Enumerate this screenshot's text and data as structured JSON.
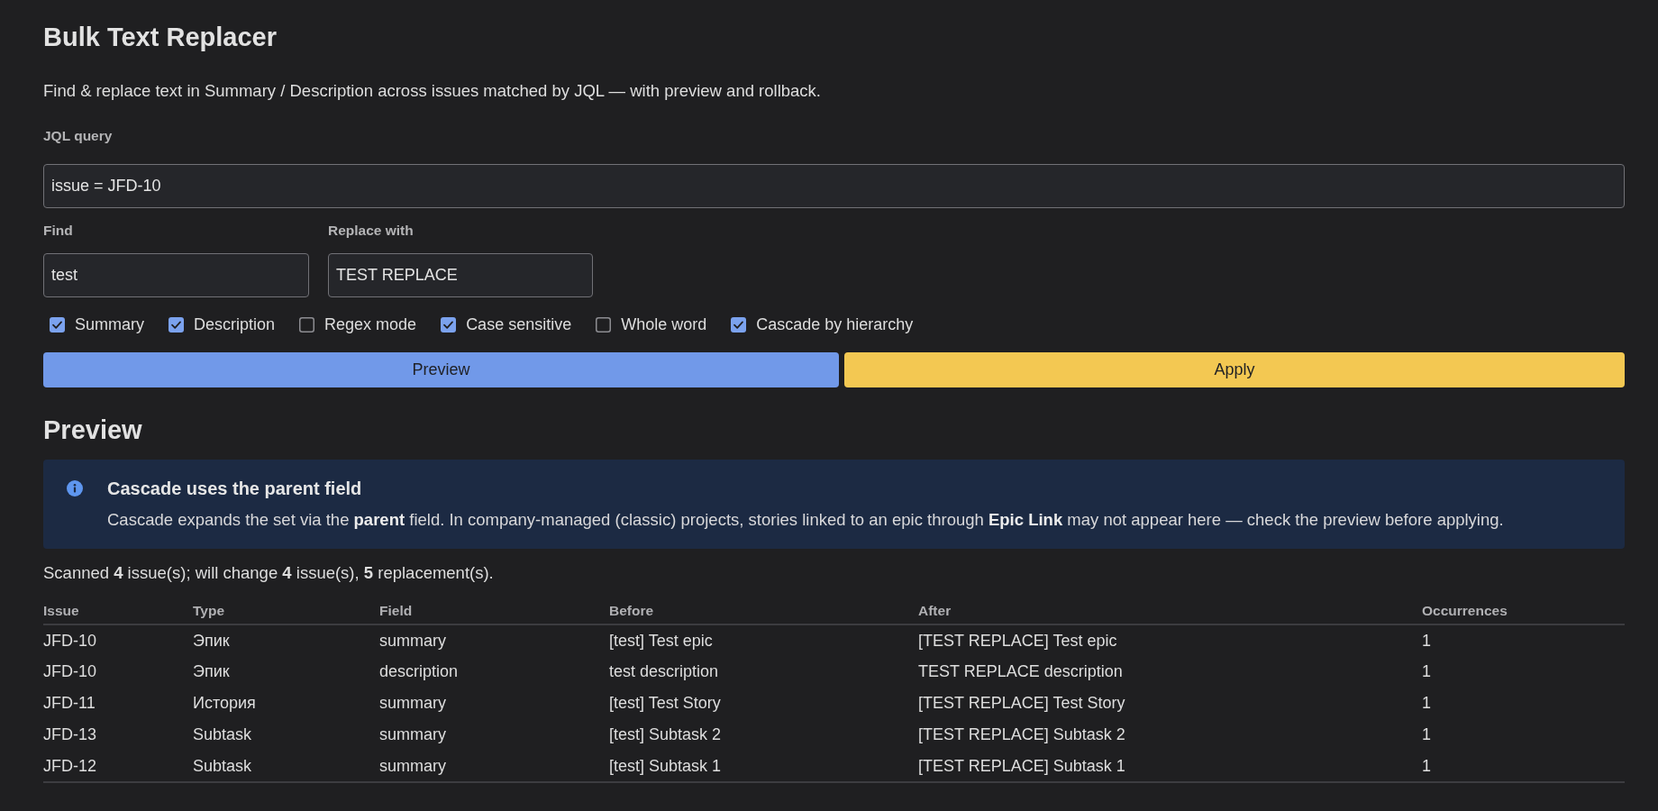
{
  "app": {
    "title": "Bulk Text Replacer",
    "subtitle": "Find & replace text in Summary / Description across issues matched by JQL — with preview and rollback."
  },
  "form": {
    "jql": {
      "label": "JQL query",
      "value": "issue = JFD-10"
    },
    "find": {
      "label": "Find",
      "value": "test"
    },
    "replace": {
      "label": "Replace with",
      "value": "TEST REPLACE"
    },
    "options": [
      {
        "label": "Summary",
        "checked": true
      },
      {
        "label": "Description",
        "checked": true
      },
      {
        "label": "Regex mode",
        "checked": false
      },
      {
        "label": "Case sensitive",
        "checked": true
      },
      {
        "label": "Whole word",
        "checked": false
      },
      {
        "label": "Cascade by hierarchy",
        "checked": true
      }
    ],
    "buttons": [
      {
        "label": "Preview",
        "kind": "primary"
      },
      {
        "label": "Apply",
        "kind": "warning"
      }
    ]
  },
  "preview": {
    "heading": "Preview",
    "notice": {
      "title": "Cascade uses the parent field",
      "body": "Cascade expands the set via the **parent** field. In company-managed (classic) projects, stories linked to an epic through **Epic Link** may not appear here — check the preview before applying."
    },
    "summary": "Scanned **4** issue(s); will change **4** issue(s), **5** replacement(s).",
    "table": {
      "columns": [
        "Issue",
        "Type",
        "Field",
        "Before",
        "After",
        "Occurrences"
      ],
      "rows": [
        [
          "JFD-10",
          "Эпик",
          "summary",
          "[test] Test epic",
          "[TEST REPLACE] Test epic",
          "1"
        ],
        [
          "JFD-10",
          "Эпик",
          "description",
          "test description",
          "TEST REPLACE description",
          "1"
        ],
        [
          "JFD-11",
          "История",
          "summary",
          "[test] Test Story",
          "[TEST REPLACE] Test Story",
          "1"
        ],
        [
          "JFD-13",
          "Subtask",
          "summary",
          "[test] Subtask 2",
          "[TEST REPLACE] Subtask 2",
          "1"
        ],
        [
          "JFD-12",
          "Subtask",
          "summary",
          "[test] Subtask 1",
          "[TEST REPLACE] Subtask 1",
          "1"
        ]
      ]
    }
  }
}
